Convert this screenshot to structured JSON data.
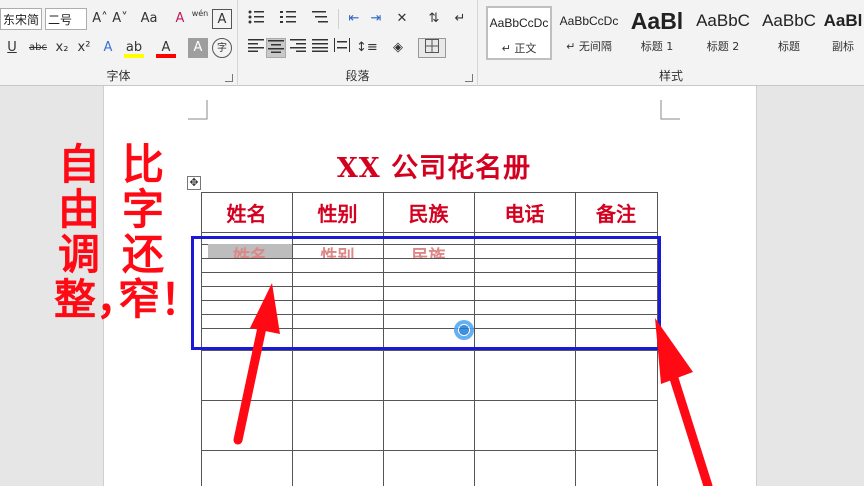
{
  "ribbon": {
    "font": {
      "label": "字体",
      "font_name": "东宋简",
      "font_size": "二号",
      "grow_icon": "A˄",
      "shrink_icon": "A˅",
      "case_label": "Aa",
      "clear_icon": "A",
      "phonetic_label": "wén",
      "border_char_label": "A",
      "underline_label": "U",
      "strike_label": "abc",
      "sub_label": "x₂",
      "sup_label": "x²",
      "effect_label": "A",
      "highlight_label": "ab",
      "color_label": "A",
      "shade_label": "A",
      "enclose_label": "字",
      "highlight_color": "#ffff00",
      "font_color": "#ff0000"
    },
    "paragraph": {
      "label": "段落"
    },
    "styles": {
      "label": "样式",
      "items": [
        {
          "sample": "AaBbCcDc",
          "name": "↵ 正文"
        },
        {
          "sample": "AaBbCcDc",
          "name": "↵ 无间隔"
        },
        {
          "sample": "AaBl",
          "name": "标题 1"
        },
        {
          "sample": "AaBbC",
          "name": "标题 2"
        },
        {
          "sample": "AaBbC",
          "name": "标题"
        },
        {
          "sample": "AaBl",
          "name": "副标"
        }
      ]
    }
  },
  "document": {
    "title": "XX 公司花名册",
    "headers": [
      "姓名",
      "性别",
      "民族",
      "电话",
      "备注"
    ],
    "ghost_row": [
      "姓名",
      "性别",
      "民族",
      "",
      ""
    ],
    "title_color": "#d4001f"
  },
  "annotations": {
    "left_text": "自由调整，",
    "right_text": "比字还窄！",
    "color": "#ff0a14",
    "selection_color": "#1a1ad6"
  }
}
